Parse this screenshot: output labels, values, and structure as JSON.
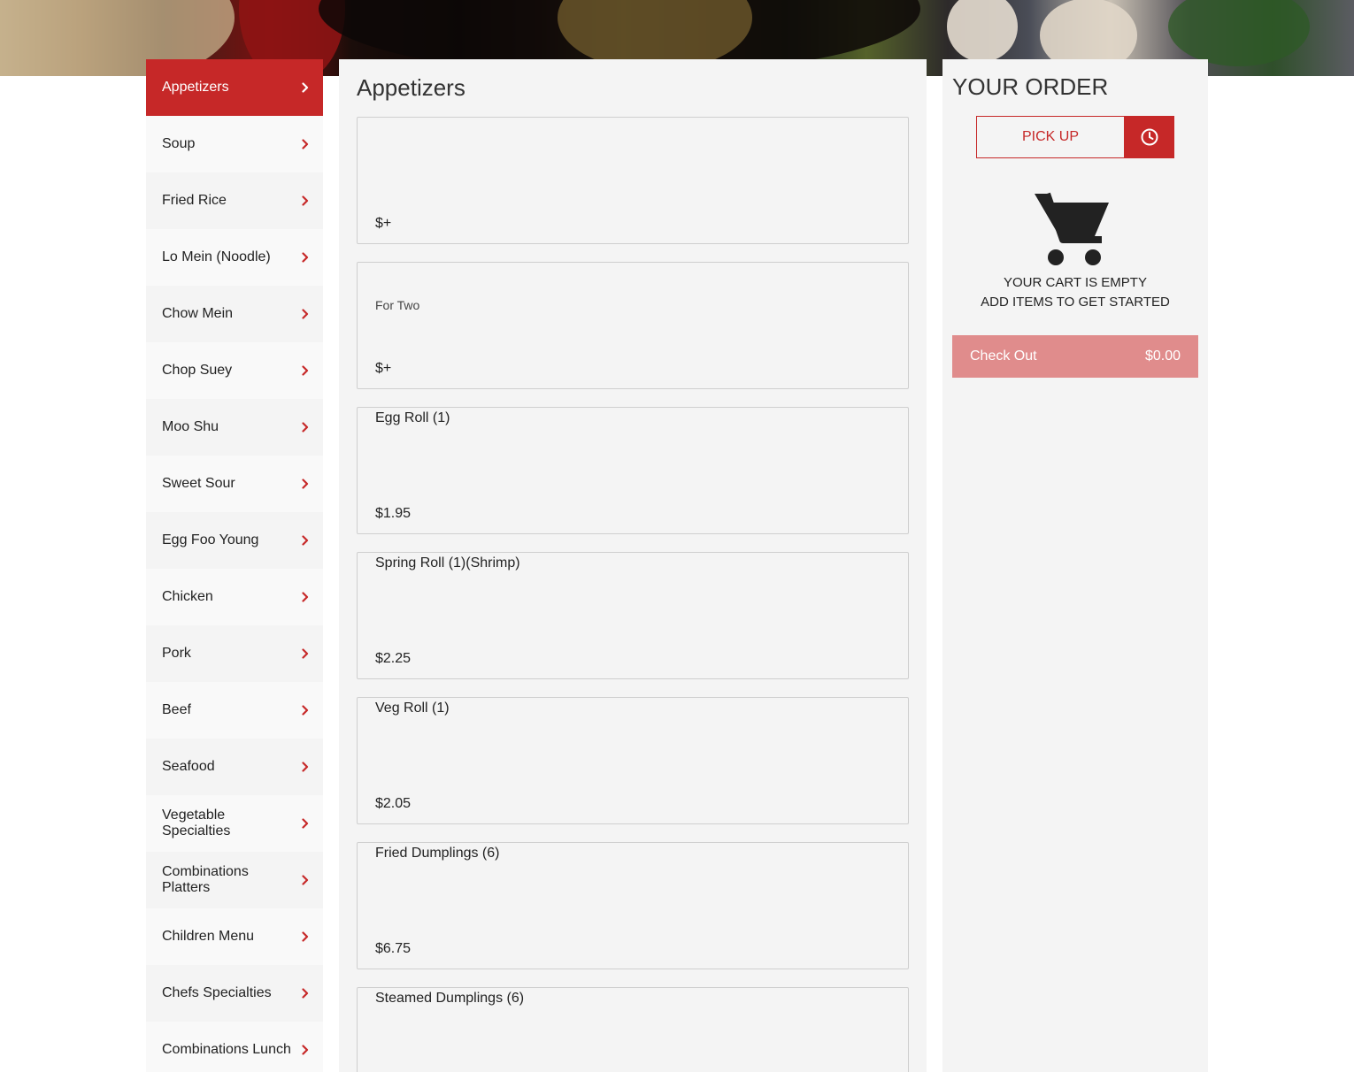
{
  "colors": {
    "accent": "#c62828",
    "panel": "#f4f4f4",
    "checkout": "#e08c8c"
  },
  "sidebar": {
    "items": [
      {
        "label": "Appetizers",
        "active": true
      },
      {
        "label": "Soup"
      },
      {
        "label": "Fried Rice"
      },
      {
        "label": "Lo Mein (Noodle)"
      },
      {
        "label": "Chow Mein"
      },
      {
        "label": "Chop Suey"
      },
      {
        "label": "Moo Shu"
      },
      {
        "label": "Sweet Sour"
      },
      {
        "label": "Egg Foo Young"
      },
      {
        "label": "Chicken"
      },
      {
        "label": "Pork"
      },
      {
        "label": "Beef"
      },
      {
        "label": "Seafood"
      },
      {
        "label": "Vegetable Specialties"
      },
      {
        "label": "Combinations Platters"
      },
      {
        "label": "Children Menu"
      },
      {
        "label": "Chefs Specialties"
      },
      {
        "label": "Combinations Lunch"
      }
    ],
    "chevron_icon": "chevron-right-icon"
  },
  "main": {
    "title": "Appetizers",
    "items": [
      {
        "name": "",
        "desc": "",
        "price": "$+"
      },
      {
        "name": "",
        "desc": "For Two",
        "price": "$+"
      },
      {
        "name": "Egg Roll (1)",
        "desc": "",
        "price": "$1.95"
      },
      {
        "name": "Spring Roll (1)(Shrimp)",
        "desc": "",
        "price": "$2.25"
      },
      {
        "name": "Veg Roll (1)",
        "desc": "",
        "price": "$2.05"
      },
      {
        "name": "Fried Dumplings (6)",
        "desc": "",
        "price": "$6.75"
      },
      {
        "name": "Steamed Dumplings (6)",
        "desc": "",
        "price": ""
      }
    ]
  },
  "order": {
    "title": "YOUR ORDER",
    "pickup_label": "PICK UP",
    "clock_icon": "clock-icon",
    "cart_icon": "shopping-cart-icon",
    "empty_line1": "YOUR CART IS EMPTY",
    "empty_line2": "ADD ITEMS TO GET STARTED",
    "checkout_label": "Check Out",
    "checkout_total": "$0.00"
  }
}
